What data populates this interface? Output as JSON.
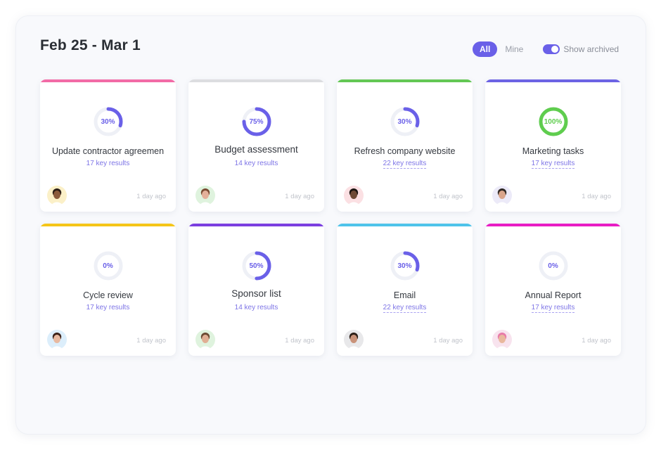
{
  "header": {
    "title": "Feb 25 - Mar 1",
    "filter_all": "All",
    "filter_mine": "Mine",
    "show_archived_label": "Show archived",
    "show_archived_on": true
  },
  "colors": {
    "accent": "#6a60e8",
    "complete": "#5fcd4e",
    "ring_track": "#eef0f6"
  },
  "cards": [
    {
      "title": "Update contractor agreemen",
      "progress": 30,
      "progress_label": "30%",
      "key_results": "17 key results",
      "time": "1 day ago",
      "bar_color": "#f26ba6",
      "avatar_bg": "#fbf0c8",
      "avatar_skin": "#8a5a3c",
      "avatar_hair": "#2a1d16",
      "kr_underline": false,
      "large": false
    },
    {
      "title": "Budget assessment",
      "progress": 75,
      "progress_label": "75%",
      "key_results": "14 key results",
      "time": "1 day ago",
      "bar_color": "#dcdde0",
      "avatar_bg": "#dff3de",
      "avatar_skin": "#e4b09a",
      "avatar_hair": "#7a4b33",
      "kr_underline": false,
      "large": true
    },
    {
      "title": "Refresh company website",
      "progress": 30,
      "progress_label": "30%",
      "key_results": "22 key results",
      "time": "1 day ago",
      "bar_color": "#63c754",
      "avatar_bg": "#fbe0e3",
      "avatar_skin": "#6e4a35",
      "avatar_hair": "#1a1410",
      "kr_underline": true,
      "large": false
    },
    {
      "title": "Marketing tasks",
      "progress": 100,
      "progress_label": "100%",
      "key_results": "17 key results",
      "time": "1 day ago",
      "bar_color": "#6c63e4",
      "avatar_bg": "#eceaf8",
      "avatar_skin": "#d9a48a",
      "avatar_hair": "#2e2723",
      "kr_underline": true,
      "large": false
    },
    {
      "title": "Cycle review",
      "progress": 0,
      "progress_label": "0%",
      "key_results": "17 key results",
      "time": "1 day ago",
      "bar_color": "#f5c518",
      "avatar_bg": "#dceefb",
      "avatar_skin": "#e8b9a0",
      "avatar_hair": "#3a2118",
      "kr_underline": false,
      "large": false
    },
    {
      "title": "Sponsor list",
      "progress": 50,
      "progress_label": "50%",
      "key_results": "14 key results",
      "time": "1 day ago",
      "bar_color": "#7b3fe0",
      "avatar_bg": "#dff3de",
      "avatar_skin": "#e0ae93",
      "avatar_hair": "#6b4a33",
      "kr_underline": false,
      "large": true
    },
    {
      "title": "Email",
      "progress": 30,
      "progress_label": "30%",
      "key_results": "22 key results",
      "time": "1 day ago",
      "bar_color": "#4ec3ea",
      "avatar_bg": "#e8e8ea",
      "avatar_skin": "#c99279",
      "avatar_hair": "#2b1e17",
      "kr_underline": true,
      "large": false
    },
    {
      "title": "Annual Report",
      "progress": 0,
      "progress_label": "0%",
      "key_results": "17 key results",
      "time": "1 day ago",
      "bar_color": "#e81cc4",
      "avatar_bg": "#f8e3ee",
      "avatar_skin": "#e9b89d",
      "avatar_hair": "#e87aa8",
      "kr_underline": true,
      "large": false
    }
  ]
}
